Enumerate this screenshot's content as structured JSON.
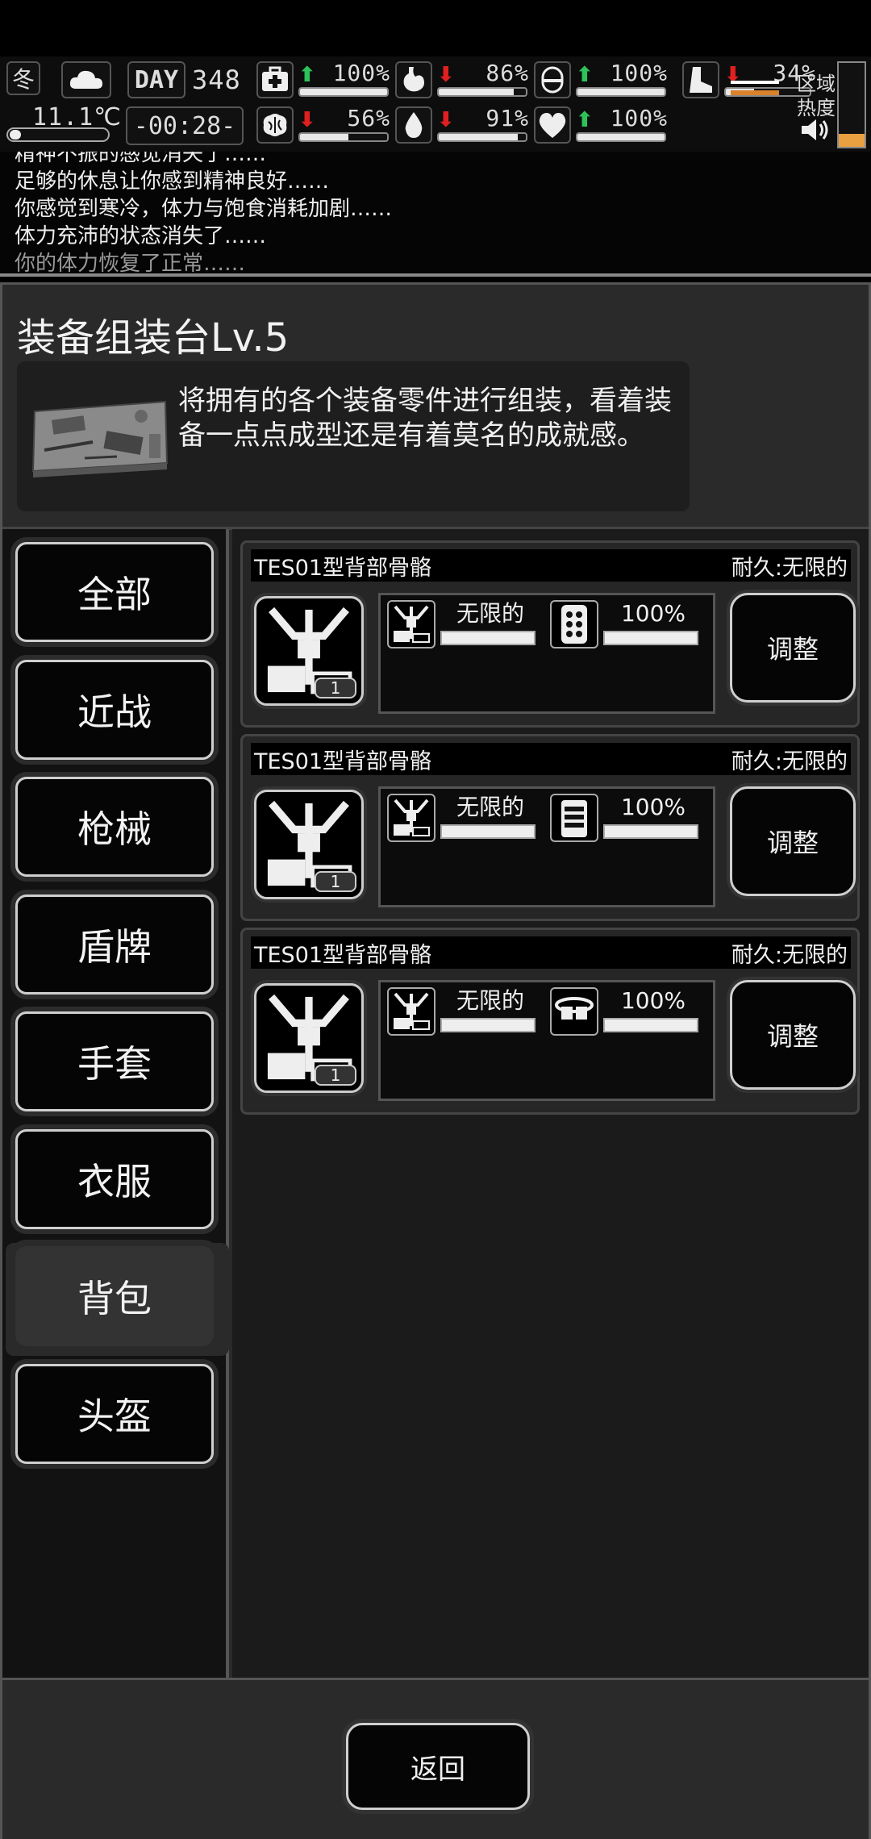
{
  "hud": {
    "season": "冬",
    "temperature": "11.1℃",
    "day_label": "DAY",
    "day": "348",
    "time": "-00:28-",
    "stats": [
      {
        "name": "health",
        "icon": "first-aid-icon",
        "trend": "up",
        "value": "100%",
        "level": 1.0
      },
      {
        "name": "hunger",
        "icon": "stomach-icon",
        "trend": "down",
        "value": "86%",
        "level": 0.86
      },
      {
        "name": "stamina",
        "icon": "pill-icon",
        "trend": "up",
        "value": "100%",
        "level": 1.0
      },
      {
        "name": "sanity",
        "icon": "brain-icon",
        "trend": "down",
        "value": "56%",
        "level": 0.56
      },
      {
        "name": "thirst",
        "icon": "water-drop-icon",
        "trend": "down",
        "value": "91%",
        "level": 0.91
      },
      {
        "name": "mood",
        "icon": "heart-icon",
        "trend": "up",
        "value": "100%",
        "level": 1.0
      },
      {
        "name": "energy",
        "icon": "boot-icon",
        "trend": "down",
        "value": "34%",
        "level": 0.34
      }
    ],
    "zone_heat_label_1": "区域",
    "zone_heat_label_2": "热度",
    "zone_heat_level": 0.15,
    "heat_color": "#e8a040"
  },
  "log": [
    "精神不振的感觉消失了……",
    "足够的休息让你感到精神良好……",
    "你感觉到寒冷，体力与饱食消耗加剧……",
    "体力充沛的状态消失了……",
    "你的体力恢复了正常……"
  ],
  "station": {
    "title": "装备组装台Lv.5",
    "description": "将拥有的各个装备零件进行组装，看着装备一点点成型还是有着莫名的成就感。"
  },
  "categories": [
    {
      "label": "全部",
      "active": false
    },
    {
      "label": "近战",
      "active": false
    },
    {
      "label": "枪械",
      "active": false
    },
    {
      "label": "盾牌",
      "active": false
    },
    {
      "label": "手套",
      "active": false
    },
    {
      "label": "衣服",
      "active": false
    },
    {
      "label": "背包",
      "active": true
    },
    {
      "label": "头盔",
      "active": false
    }
  ],
  "items": [
    {
      "name": "TES01型背部骨骼",
      "durability": "耐久:无限的",
      "count": "1",
      "part1": {
        "icon": "exoskeleton-icon",
        "value": "无限的",
        "level": 1.0
      },
      "part2": {
        "icon": "plate-module-icon",
        "value": "100%",
        "level": 1.0
      },
      "action": "调整"
    },
    {
      "name": "TES01型背部骨骼",
      "durability": "耐久:无限的",
      "count": "1",
      "part1": {
        "icon": "exoskeleton-icon",
        "value": "无限的",
        "level": 1.0
      },
      "part2": {
        "icon": "storage-box-icon",
        "value": "100%",
        "level": 1.0
      },
      "action": "调整"
    },
    {
      "name": "TES01型背部骨骼",
      "durability": "耐久:无限的",
      "count": "1",
      "part1": {
        "icon": "exoskeleton-icon",
        "value": "无限的",
        "level": 1.0
      },
      "part2": {
        "icon": "belt-pouch-icon",
        "value": "100%",
        "level": 1.0
      },
      "action": "调整"
    }
  ],
  "footer": {
    "back_label": "返回"
  }
}
